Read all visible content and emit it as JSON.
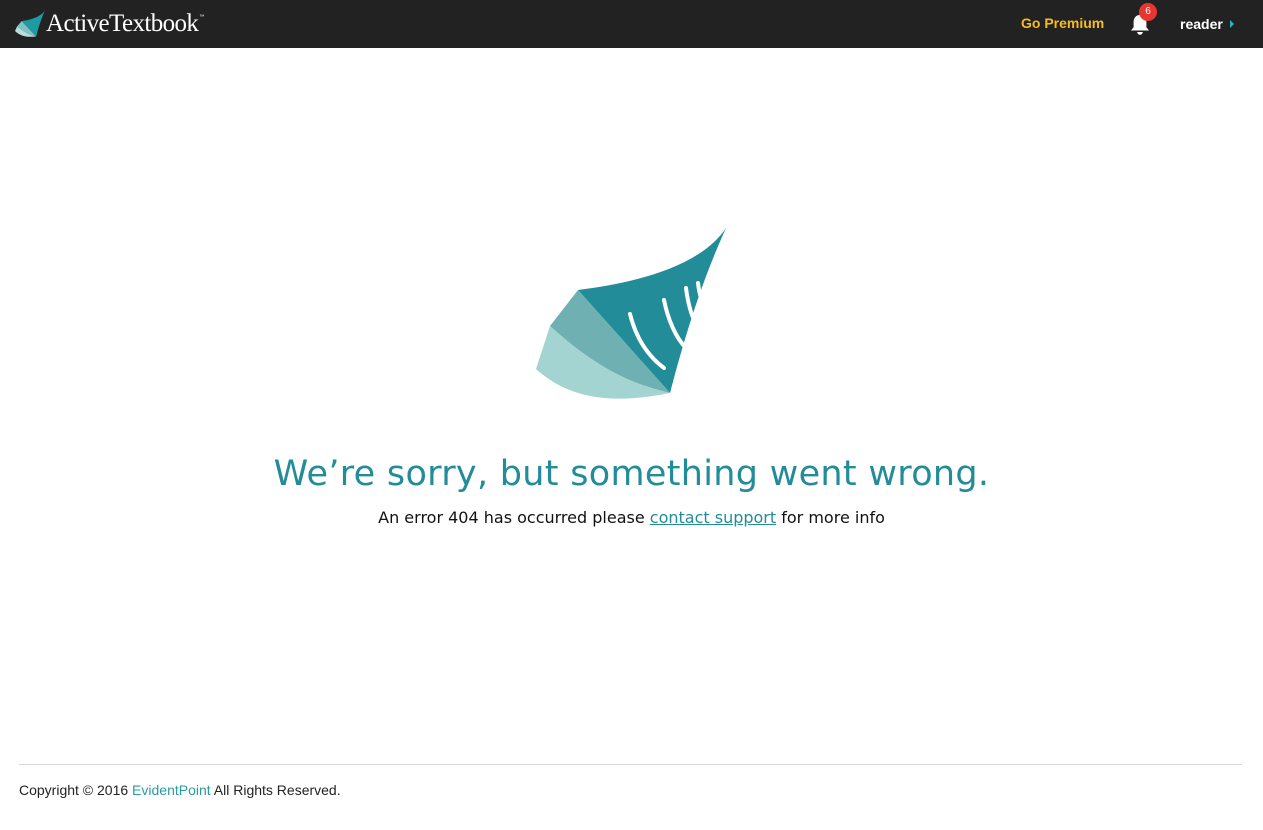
{
  "header": {
    "brand_name": "ActiveTextbook",
    "brand_tm": "™",
    "go_premium_label": "Go Premium",
    "notification_count": "6",
    "user_name": "reader",
    "icons": {
      "logo": "activetextbook-logo-icon",
      "bell": "bell-icon",
      "caret": "caret-right-icon"
    },
    "colors": {
      "background": "#222222",
      "premium": "#f5bd1f",
      "badge": "#e8352e",
      "caret": "#2ab3c0"
    }
  },
  "error": {
    "title": "We’re sorry, but something went wrong.",
    "message_prefix": "An error 404 has occurred please",
    "link_label": "contact support",
    "message_suffix": "for more info",
    "colors": {
      "accent": "#228c98",
      "logo_dark": "#228c98",
      "logo_mid": "#6fb0b3",
      "logo_light": "#a3d4d2"
    }
  },
  "footer": {
    "copyright_prefix": "Copyright © 2016",
    "company_link": "EvidentPoint",
    "copyright_suffix": "All Rights Reserved."
  }
}
